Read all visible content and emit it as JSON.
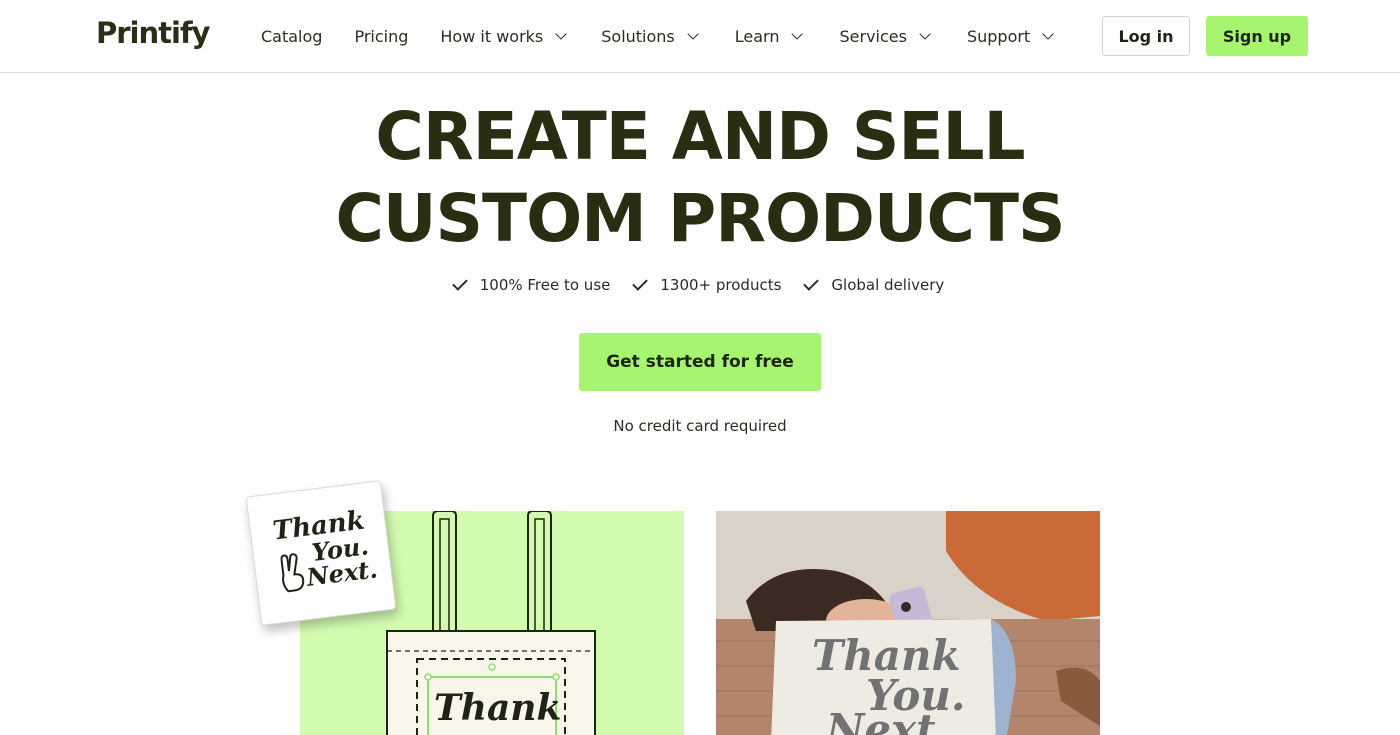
{
  "brand": {
    "logo_text": "Printify",
    "accent_color": "#a7f56e",
    "text_color": "#2b2d12"
  },
  "nav": {
    "items": [
      {
        "label": "Catalog",
        "has_dropdown": false
      },
      {
        "label": "Pricing",
        "has_dropdown": false
      },
      {
        "label": "How it works",
        "has_dropdown": true
      },
      {
        "label": "Solutions",
        "has_dropdown": true
      },
      {
        "label": "Learn",
        "has_dropdown": true
      },
      {
        "label": "Services",
        "has_dropdown": true
      },
      {
        "label": "Support",
        "has_dropdown": true
      }
    ],
    "login_label": "Log in",
    "signup_label": "Sign up"
  },
  "hero": {
    "title_line1": "CREATE AND SELL",
    "title_line2": "CUSTOM PRODUCTS",
    "features": [
      "100% Free to use",
      "1300+ products",
      "Global delivery"
    ],
    "cta_label": "Get started for free",
    "note": "No credit card required"
  },
  "imagery": {
    "sticker_text": [
      "Thank",
      "You.",
      "Next."
    ],
    "tote_text": "Thank",
    "photo_text": [
      "Thank",
      "You.",
      "Next"
    ]
  }
}
